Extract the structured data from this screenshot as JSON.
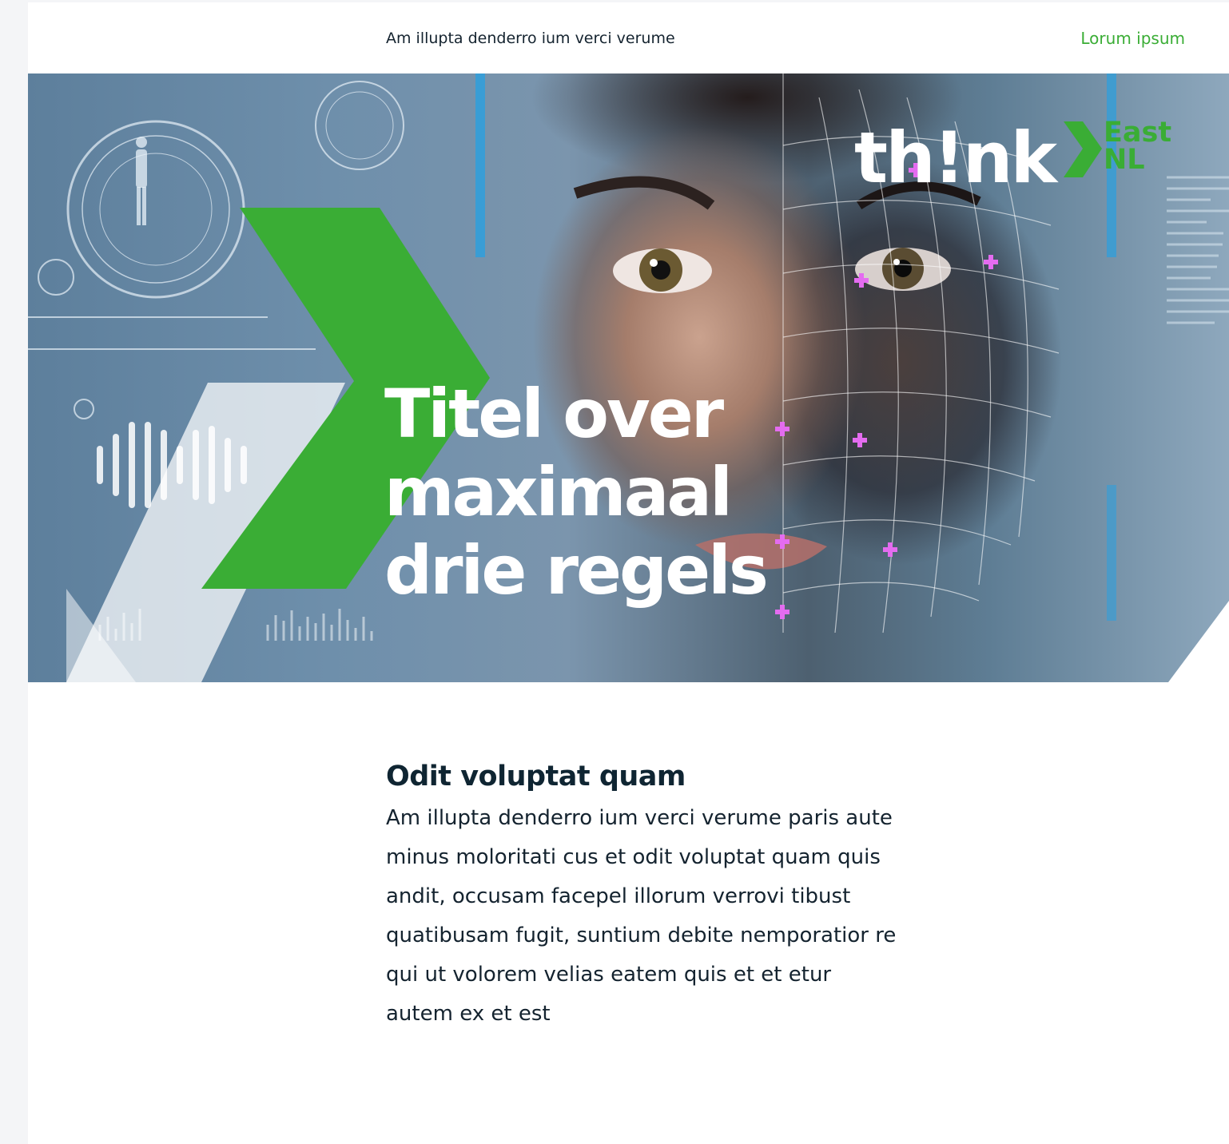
{
  "header": {
    "preheader_text": "Am illupta denderro ium verci verume",
    "web_link": "Lorum ipsum"
  },
  "hero": {
    "logo": {
      "wordmark": "th!nk",
      "region_line1": "East",
      "region_line2": "NL",
      "brand_green": "#3aad35",
      "icon": "chevron-right-icon"
    },
    "title": "Titel over maximaal drie regels"
  },
  "article": {
    "heading": "Odit voluptat quam",
    "body": "Am illupta denderro ium verci verume paris aute minus moloritati cus et odit voluptat quam quis andit, occusam facepel illorum verrovi tibust quatibusam fugit, suntium debite nemporatior re qui ut volorem velias eatem quis et et etur autem ex et est"
  },
  "colors": {
    "accent": "#3aad35",
    "text_dark": "#0f2532",
    "page_bg": "#f4f5f7"
  }
}
